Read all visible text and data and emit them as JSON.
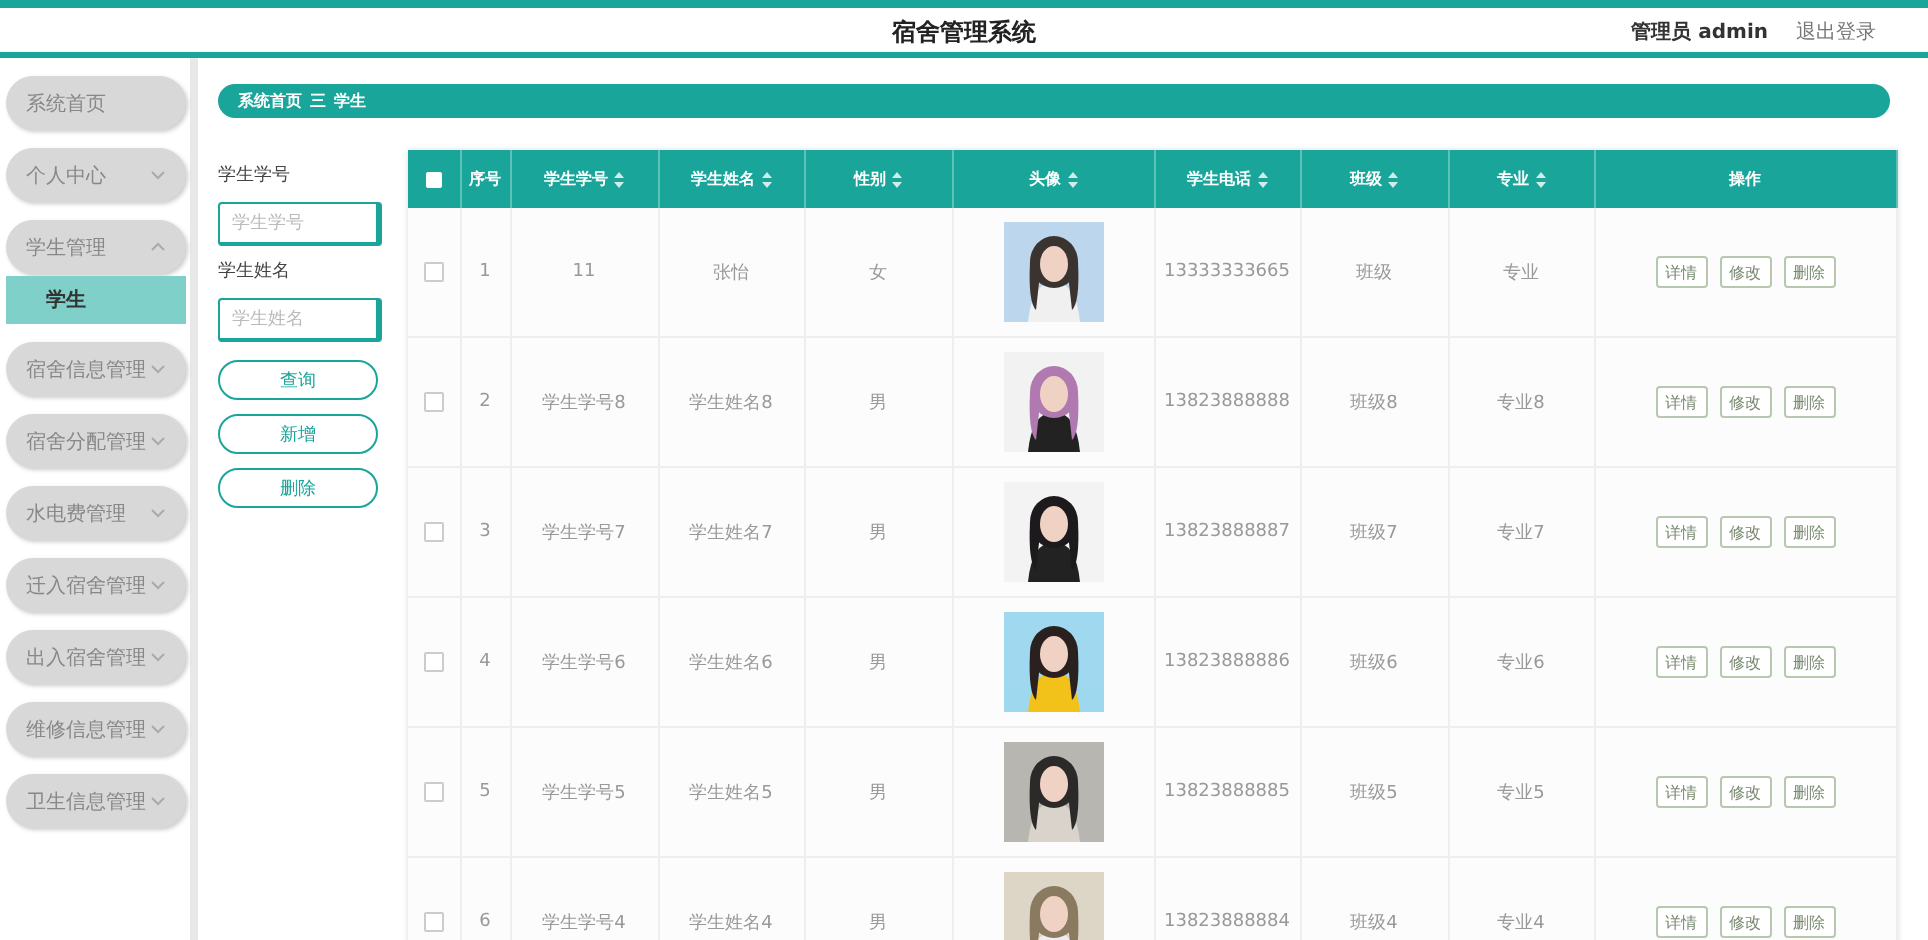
{
  "header": {
    "title": "宿舍管理系统",
    "user": "管理员 admin",
    "logout": "退出登录"
  },
  "sidebar": {
    "items": [
      {
        "label": "系统首页",
        "kind": "link"
      },
      {
        "label": "个人中心",
        "kind": "menu",
        "expanded": false
      },
      {
        "label": "学生管理",
        "kind": "menu",
        "expanded": true,
        "children": [
          {
            "label": "学生",
            "selected": true
          }
        ]
      },
      {
        "label": "宿舍信息管理",
        "kind": "menu",
        "expanded": false
      },
      {
        "label": "宿舍分配管理",
        "kind": "menu",
        "expanded": false
      },
      {
        "label": "水电费管理",
        "kind": "menu",
        "expanded": false
      },
      {
        "label": "迁入宿舍管理",
        "kind": "menu",
        "expanded": false
      },
      {
        "label": "出入宿舍管理",
        "kind": "menu",
        "expanded": false
      },
      {
        "label": "维修信息管理",
        "kind": "menu",
        "expanded": false
      },
      {
        "label": "卫生信息管理",
        "kind": "menu",
        "expanded": false
      }
    ]
  },
  "breadcrumb": {
    "items": [
      "系统首页",
      "学生"
    ],
    "separator": "三"
  },
  "search": {
    "fields": [
      {
        "label": "学生学号",
        "placeholder": "学生学号"
      },
      {
        "label": "学生姓名",
        "placeholder": "学生姓名"
      }
    ],
    "buttons": [
      "查询",
      "新增",
      "删除"
    ]
  },
  "table": {
    "select_all": {
      "checked": false
    },
    "columns": [
      {
        "label": "序号",
        "sortable": false
      },
      {
        "label": "学生学号",
        "sortable": true
      },
      {
        "label": "学生姓名",
        "sortable": true
      },
      {
        "label": "性别",
        "sortable": true
      },
      {
        "label": "头像",
        "sortable": true
      },
      {
        "label": "学生电话",
        "sortable": true
      },
      {
        "label": "班级",
        "sortable": true
      },
      {
        "label": "专业",
        "sortable": true
      },
      {
        "label": "操作",
        "sortable": false
      }
    ],
    "rows": [
      {
        "checked": false,
        "cells": [
          "1",
          "11",
          "张怡",
          "女"
        ],
        "photo": {
          "kind": "picture"
        },
        "cells_after": [
          "13333333665",
          "班级",
          "专业"
        ],
        "actions": [
          "详情",
          "修改",
          "删除"
        ]
      },
      {
        "checked": false,
        "cells": [
          "2",
          "学生学号8",
          "学生姓名8",
          "男"
        ],
        "photo": {
          "kind": "picture"
        },
        "cells_after": [
          "13823888888",
          "班级8",
          "专业8"
        ],
        "actions": [
          "详情",
          "修改",
          "删除"
        ]
      },
      {
        "checked": false,
        "cells": [
          "3",
          "学生学号7",
          "学生姓名7",
          "男"
        ],
        "photo": {
          "kind": "picture"
        },
        "cells_after": [
          "13823888887",
          "班级7",
          "专业7"
        ],
        "actions": [
          "详情",
          "修改",
          "删除"
        ]
      },
      {
        "checked": false,
        "cells": [
          "4",
          "学生学号6",
          "学生姓名6",
          "男"
        ],
        "photo": {
          "kind": "picture"
        },
        "cells_after": [
          "13823888886",
          "班级6",
          "专业6"
        ],
        "actions": [
          "详情",
          "修改",
          "删除"
        ]
      },
      {
        "checked": false,
        "cells": [
          "5",
          "学生学号5",
          "学生姓名5",
          "男"
        ],
        "photo": {
          "kind": "picture"
        },
        "cells_after": [
          "13823888885",
          "班级5",
          "专业5"
        ],
        "actions": [
          "详情",
          "修改",
          "删除"
        ]
      },
      {
        "checked": false,
        "cells": [
          "6",
          "学生学号4",
          "学生姓名4",
          "男"
        ],
        "photo": {
          "kind": "picture"
        },
        "cells_after": [
          "13823888884",
          "班级4",
          "专业4"
        ],
        "actions": [
          "详情",
          "修改",
          "删除"
        ]
      }
    ]
  }
}
